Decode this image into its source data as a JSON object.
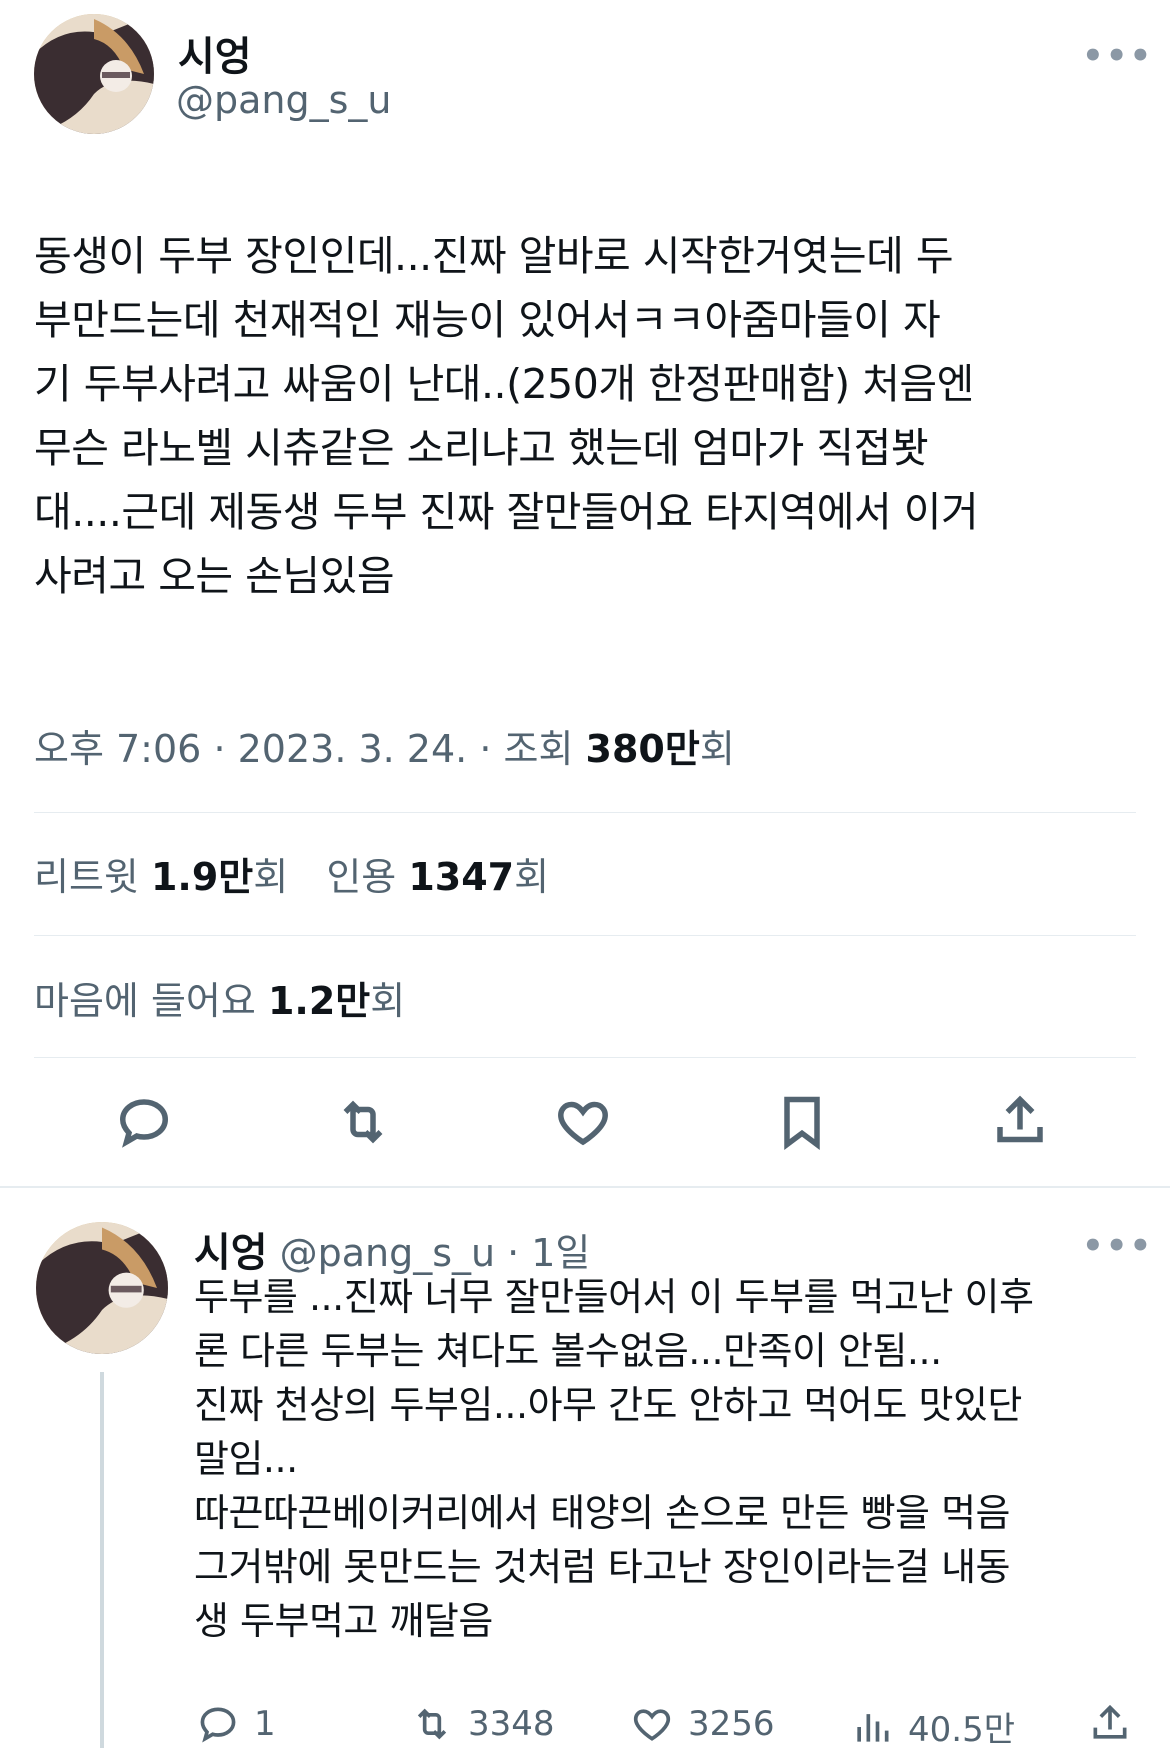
{
  "main_tweet": {
    "author_name": "시엉",
    "author_handle": "@pang_s_u",
    "text": "동생이 두부 장인인데...진짜 알바로 시작한거엿는데 두\n부만드는데 천재적인 재능이 있어서ㅋㅋ아줌마들이 자\n기 두부사려고 싸움이 난대..(250개 한정판매함) 처음엔\n무슨 라노벨 시츄같은 소리냐고 했는데 엄마가 직접봣\n대....근데 제동생 두부 진짜 잘만들어요 타지역에서 이거\n사려고 오는 손님있음",
    "time": "오후 7:06",
    "date": "2023. 3. 24.",
    "views_label": "조회",
    "views_value": "380만",
    "views_suffix": "회",
    "retweets_label": "리트윗",
    "retweets_value": "1.9만",
    "retweets_suffix": "회",
    "quotes_label": "인용",
    "quotes_value": "1347",
    "quotes_suffix": "회",
    "likes_label": "마음에 들어요",
    "likes_value": "1.2만",
    "likes_suffix": "회",
    "more_glyph": "•••"
  },
  "reply": {
    "author_name": "시엉",
    "author_handle": "@pang_s_u",
    "dot": "·",
    "time_ago": "1일",
    "text": "두부를 ...진짜 너무 잘만들어서 이 두부를 먹고난 이후\n론 다른 두부는 쳐다도 볼수없음...만족이 안됨...\n진짜 천상의 두부임...아무 간도 안하고 먹어도 맛있단\n말임...\n따끈따끈베이커리에서 태양의 손으로 만든 빵을 먹음\n그거밖에 못만드는 것처럼 타고난 장인이라는걸 내동\n생 두부먹고 깨달음",
    "reply_count": "1",
    "retweet_count": "3348",
    "like_count": "3256",
    "view_count": "40.5만",
    "more_glyph": "•••"
  },
  "icons": [
    "reply-icon",
    "retweet-icon",
    "like-icon",
    "bookmark-icon",
    "share-icon",
    "views-icon",
    "more-icon",
    "avatar"
  ]
}
